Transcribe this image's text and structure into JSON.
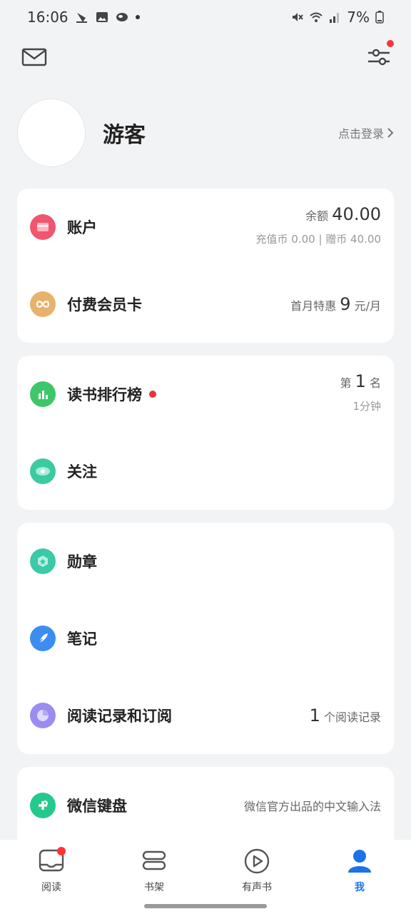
{
  "status_bar": {
    "time": "16:06",
    "battery": "7%"
  },
  "profile": {
    "username": "游客",
    "login_label": "点击登录"
  },
  "account": {
    "label": "账户",
    "balance_label": "余额",
    "balance_value": "40.00",
    "coin_detail": "充值币 0.00 | 赠币 40.00",
    "icon_color": "#f0566e"
  },
  "membership": {
    "label": "付费会员卡",
    "promo_prefix": "首月特惠",
    "promo_value": "9",
    "promo_suffix": "元/月",
    "icon_color": "#e9b26c"
  },
  "ranking": {
    "label": "读书排行榜",
    "rank_prefix": "第",
    "rank_value": "1",
    "rank_suffix": "名",
    "time": "1分钟",
    "icon_color": "#3ec66b"
  },
  "follow": {
    "label": "关注",
    "icon_color": "#3ccaa0"
  },
  "badge": {
    "label": "勋章",
    "icon_color": "#3cc9a8"
  },
  "notes": {
    "label": "笔记",
    "icon_color": "#3b8df0"
  },
  "history": {
    "label": "阅读记录和订阅",
    "count": "1",
    "count_suffix": "个阅读记录",
    "icon_color": "#9a8cf0"
  },
  "keyboard": {
    "label": "微信键盘",
    "description": "微信官方出品的中文输入法",
    "icon_color": "#25c98b"
  },
  "nav": {
    "items": [
      {
        "label": "阅读"
      },
      {
        "label": "书架"
      },
      {
        "label": "有声书"
      },
      {
        "label": "我"
      }
    ],
    "active_color": "#1a73e8"
  }
}
